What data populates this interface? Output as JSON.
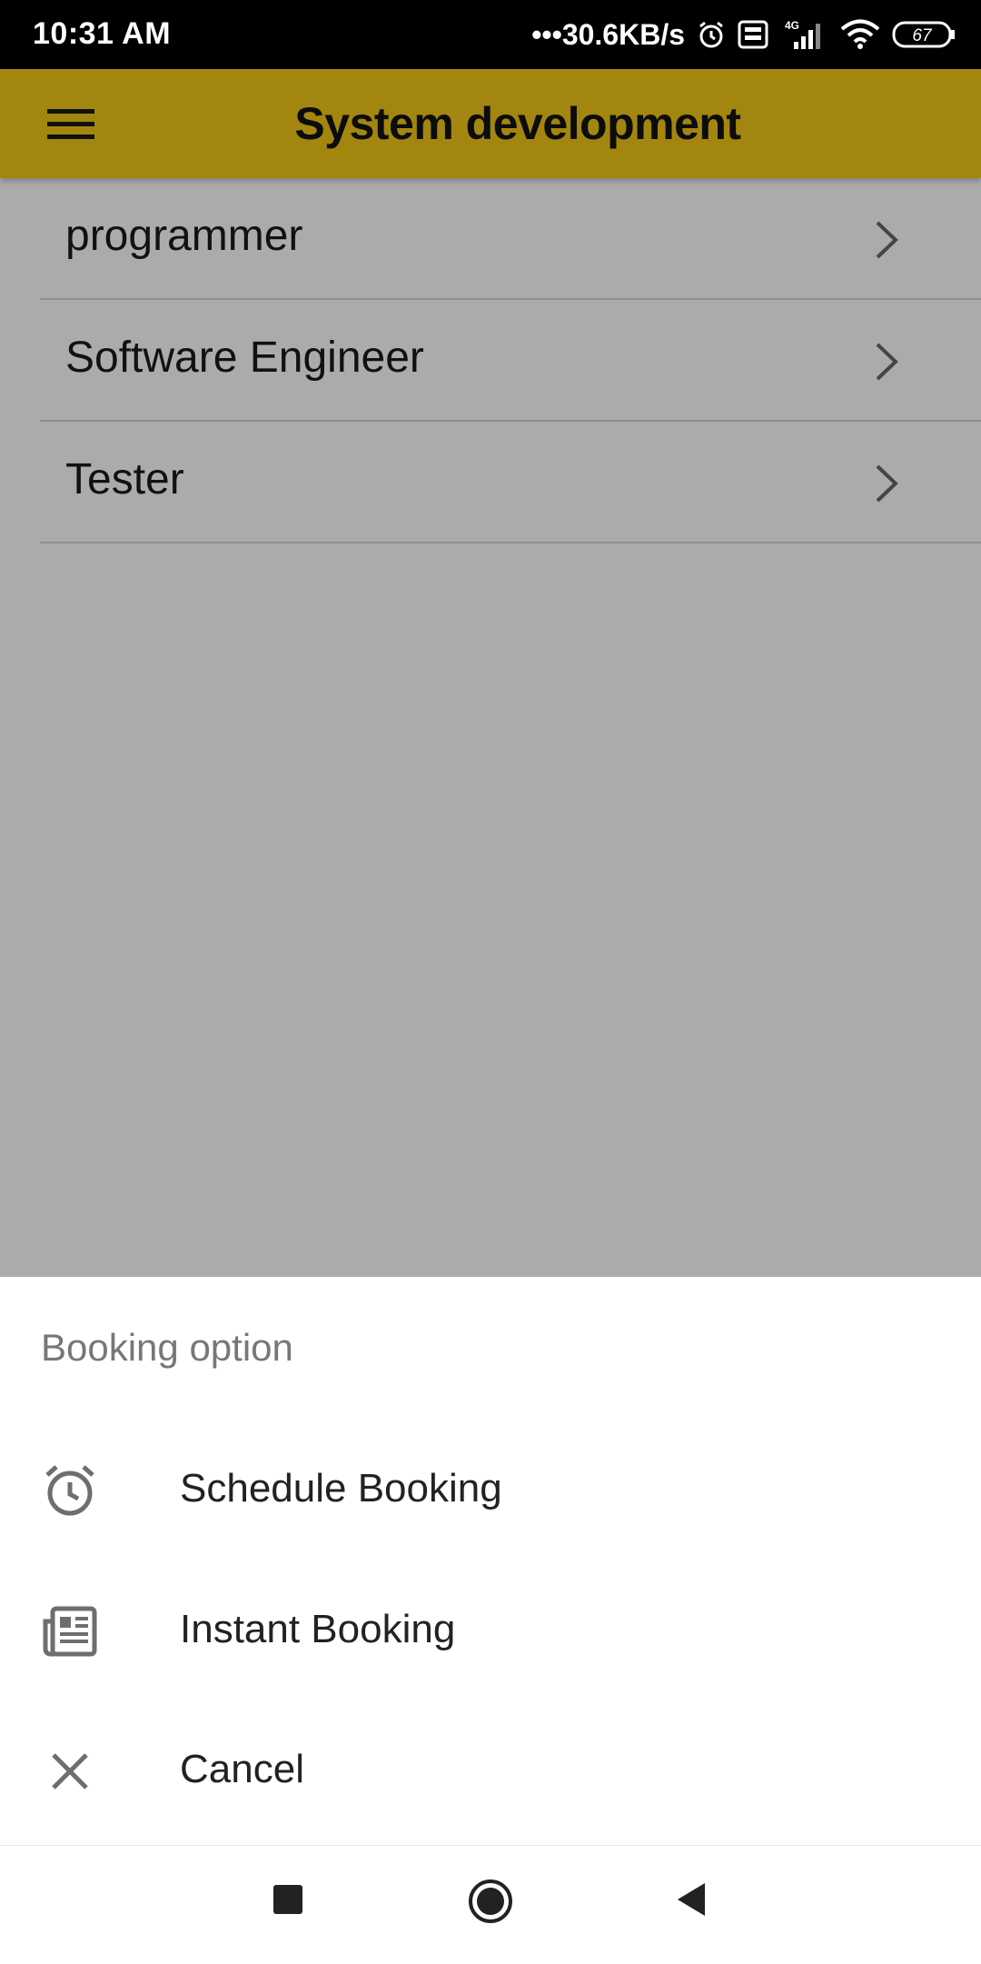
{
  "status_bar": {
    "time": "10:31 AM",
    "net_speed": "•••30.6KB/s",
    "network": "4G",
    "battery": "67"
  },
  "app_bar": {
    "title": "System development",
    "menu_icon": "hamburger-menu-icon"
  },
  "list": {
    "items": [
      {
        "label": "programmer"
      },
      {
        "label": "Software Engineer"
      },
      {
        "label": "Tester"
      }
    ]
  },
  "bottom_sheet": {
    "title": "Booking option",
    "items": [
      {
        "label": "Schedule Booking",
        "icon": "alarm-clock-icon"
      },
      {
        "label": "Instant Booking",
        "icon": "newspaper-icon"
      },
      {
        "label": "Cancel",
        "icon": "close-icon"
      }
    ]
  },
  "nav_bar": {
    "buttons": [
      "recents-icon",
      "home-icon",
      "back-icon"
    ]
  },
  "colors": {
    "app_bar": "#a3860f",
    "scrim": "#ababab",
    "status_bar": "#000000",
    "sheet": "#ffffff"
  }
}
